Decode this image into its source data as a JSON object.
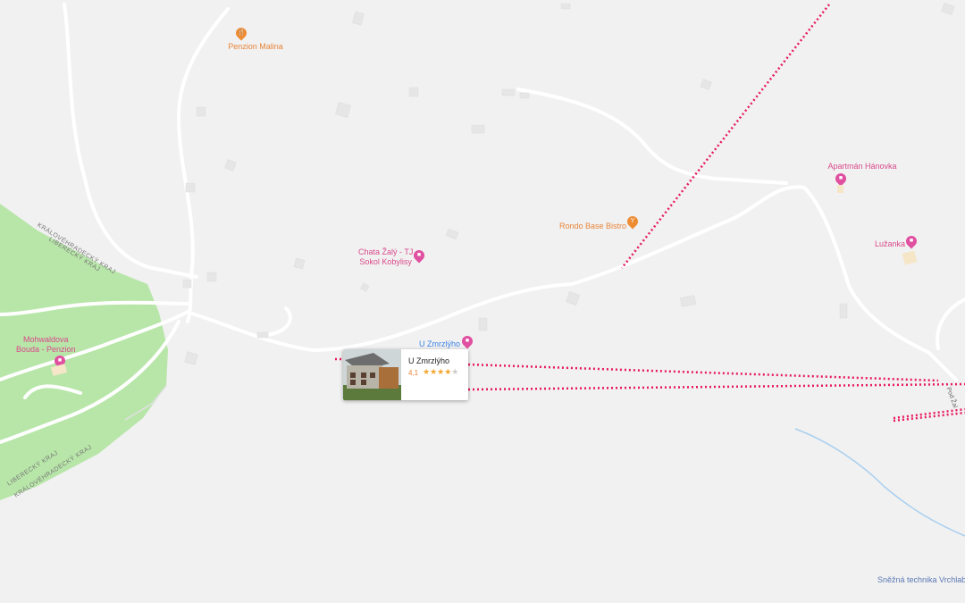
{
  "colors": {
    "background": "#f1f1f1",
    "park": "#b8e6a9",
    "road": "#ffffff",
    "border_route": "#e8175d",
    "stream": "#a8cff0",
    "poi_pink": "#e04fa0",
    "poi_orange": "#ee8c34"
  },
  "places": {
    "penzion_malina": {
      "name": "Penzion Malina",
      "icon": "restaurant-icon"
    },
    "apartman_hanovka": {
      "name": "Apartmán Hánovka",
      "icon": "lodging-icon"
    },
    "rondo_base_bistro": {
      "name": "Rondo Base Bistro",
      "icon": "bar-icon"
    },
    "luzanka": {
      "name": "Lužanka",
      "icon": "lodging-icon"
    },
    "chata_zaly_line1": "Chata Žalý - TJ",
    "chata_zaly_line2": "Sokol Kobylisy",
    "mohwaldova_line1": "Mohwaldova",
    "mohwaldova_line2": "Bouda - Penzion",
    "u_zmrzlyho_label": "U Zmrzlýho",
    "snezna_technika": "Sněžná technika Vrchlab",
    "pod_zaly": "Pod Žal"
  },
  "regions": {
    "upper_line1": "KRÁLOVÉHRADECKÝ KRAJ",
    "upper_line2": "LIBERECKÝ KRAJ",
    "lower_line1": "LIBERECKÝ KRAJ",
    "lower_line2": "KRÁLOVÉHRADECKÝ KRAJ"
  },
  "info_card": {
    "title": "U Zmrzlýho",
    "rating_text": "4,1",
    "stars_on": "★★★★",
    "stars_off": "★",
    "rating_value": 4.1
  }
}
